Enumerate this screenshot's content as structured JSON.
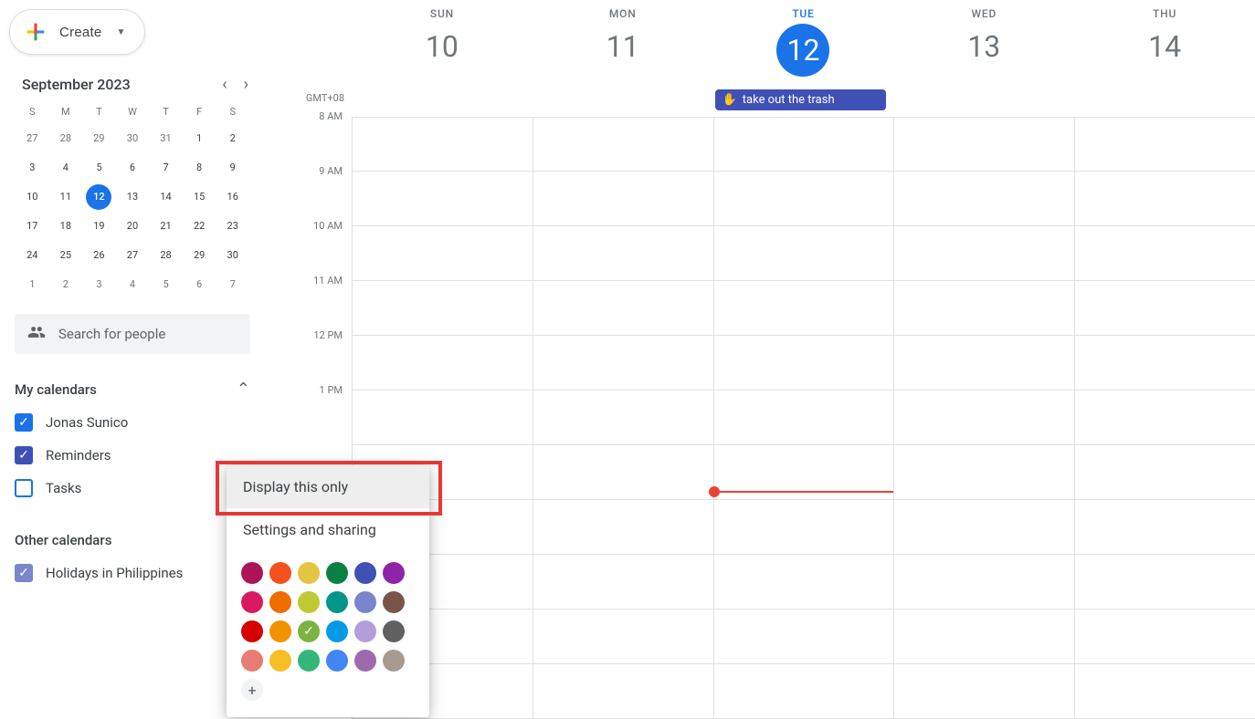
{
  "create_label": "Create",
  "timezone": "GMT+08",
  "mini_cal": {
    "title": "September 2023",
    "dow": [
      "S",
      "M",
      "T",
      "W",
      "T",
      "F",
      "S"
    ],
    "days": [
      {
        "n": "27",
        "o": true
      },
      {
        "n": "28",
        "o": true
      },
      {
        "n": "29",
        "o": true
      },
      {
        "n": "30",
        "o": true
      },
      {
        "n": "31",
        "o": true
      },
      {
        "n": "1"
      },
      {
        "n": "2"
      },
      {
        "n": "3"
      },
      {
        "n": "4"
      },
      {
        "n": "5"
      },
      {
        "n": "6"
      },
      {
        "n": "7"
      },
      {
        "n": "8"
      },
      {
        "n": "9"
      },
      {
        "n": "10"
      },
      {
        "n": "11"
      },
      {
        "n": "12",
        "today": true
      },
      {
        "n": "13"
      },
      {
        "n": "14"
      },
      {
        "n": "15"
      },
      {
        "n": "16"
      },
      {
        "n": "17"
      },
      {
        "n": "18"
      },
      {
        "n": "19"
      },
      {
        "n": "20"
      },
      {
        "n": "21"
      },
      {
        "n": "22"
      },
      {
        "n": "23"
      },
      {
        "n": "24"
      },
      {
        "n": "25"
      },
      {
        "n": "26"
      },
      {
        "n": "27"
      },
      {
        "n": "28"
      },
      {
        "n": "29"
      },
      {
        "n": "30"
      },
      {
        "n": "1",
        "o": true
      },
      {
        "n": "2",
        "o": true
      },
      {
        "n": "3",
        "o": true
      },
      {
        "n": "4",
        "o": true
      },
      {
        "n": "5",
        "o": true
      },
      {
        "n": "6",
        "o": true
      },
      {
        "n": "7",
        "o": true
      }
    ]
  },
  "search_placeholder": "Search for people",
  "my_calendars_label": "My calendars",
  "other_calendars_label": "Other calendars",
  "calendars": [
    {
      "label": "Jonas Sunico",
      "checked": true,
      "color": "#1a73e8"
    },
    {
      "label": "Reminders",
      "checked": true,
      "color": "#3f51b5"
    },
    {
      "label": "Tasks",
      "checked": false,
      "color": "#1a73e8"
    }
  ],
  "other_calendars": [
    {
      "label": "Holidays in Philippines",
      "checked": true,
      "color": "#7986cb"
    }
  ],
  "week_days": [
    {
      "dow": "SUN",
      "num": "10"
    },
    {
      "dow": "MON",
      "num": "11"
    },
    {
      "dow": "TUE",
      "num": "12",
      "today": true
    },
    {
      "dow": "WED",
      "num": "13"
    },
    {
      "dow": "THU",
      "num": "14"
    }
  ],
  "times": [
    "8 AM",
    "9 AM",
    "10 AM",
    "11 AM",
    "12 PM",
    "1 PM",
    "",
    "",
    "",
    "",
    ""
  ],
  "event_title": "take out the trash",
  "popup": {
    "display_only": "Display this only",
    "settings": "Settings and sharing",
    "colors": [
      "#ad1457",
      "#f4511e",
      "#e4c441",
      "#0b8043",
      "#3f51b5",
      "#8e24aa",
      "#d81b60",
      "#ef6c00",
      "#c0ca33",
      "#009688",
      "#7986cb",
      "#795548",
      "#d50000",
      "#f09300",
      "#7cb342",
      "#039be5",
      "#b39ddb",
      "#616161",
      "#e67c73",
      "#f6bf26",
      "#33b679",
      "#4285f4",
      "#9e69af",
      "#a79b8e"
    ],
    "selected_color_index": 14
  }
}
